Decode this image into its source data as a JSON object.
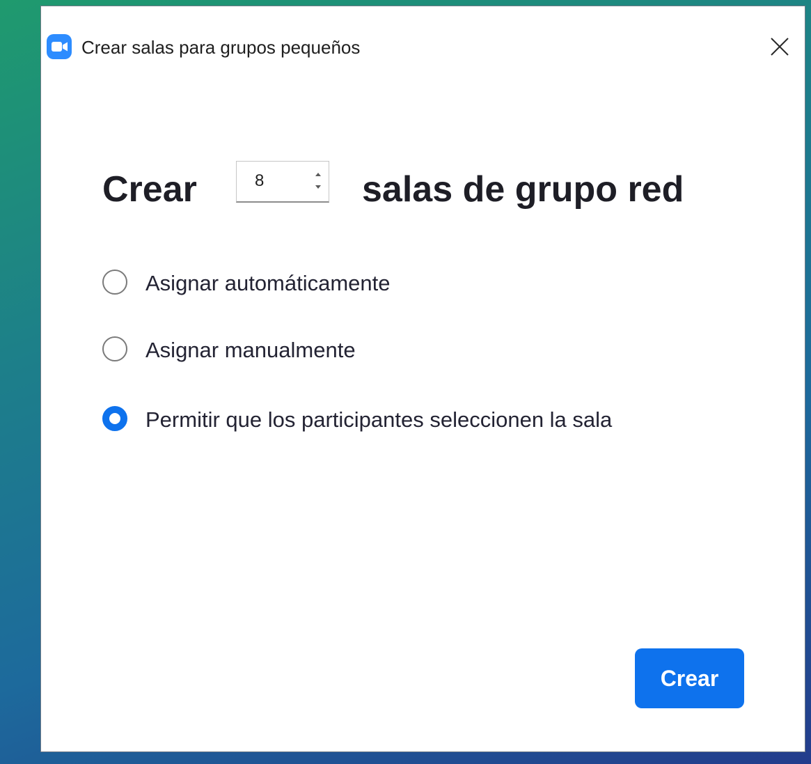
{
  "window": {
    "title": "Crear salas para grupos pequeños",
    "app_icon": "zoom-camera-icon",
    "close_icon": "close-icon"
  },
  "heading": {
    "prefix": "Crear",
    "suffix": "salas de grupo red",
    "room_count": "8"
  },
  "options": [
    {
      "label": "Asignar automáticamente",
      "checked": false
    },
    {
      "label": "Asignar manualmente",
      "checked": false
    },
    {
      "label": "Permitir que los participantes seleccionen la sala",
      "checked": true
    }
  ],
  "footer": {
    "create_label": "Crear"
  },
  "colors": {
    "accent": "#0e72ed",
    "app_icon": "#2d8cff",
    "text_dark": "#1e1e26"
  }
}
